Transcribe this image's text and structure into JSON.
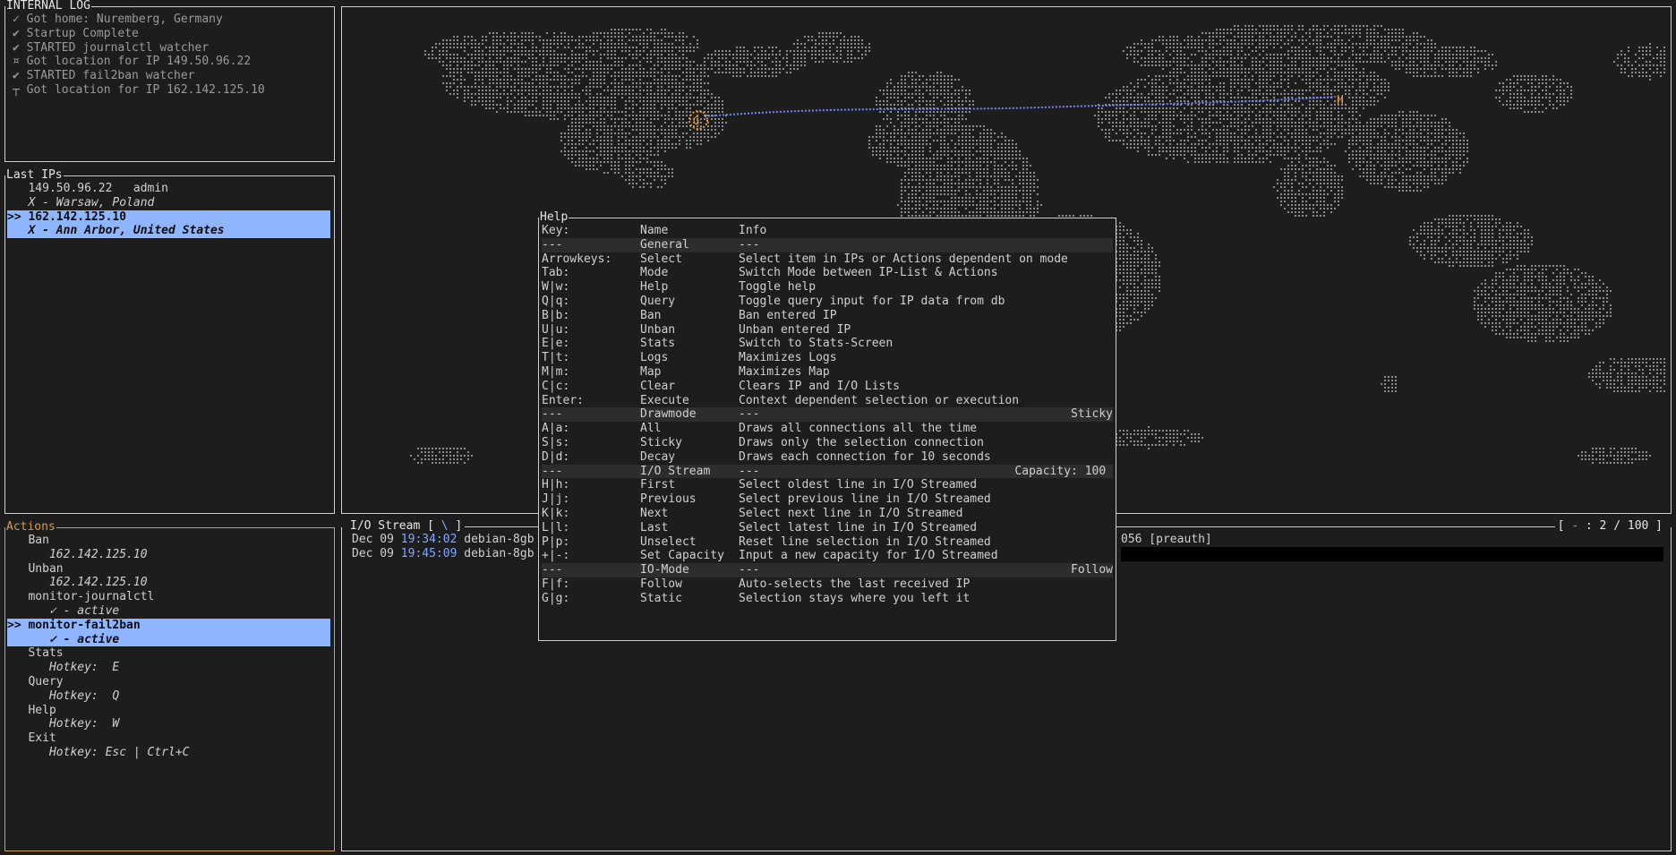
{
  "log_panel": {
    "title": "INTERNAL LOG",
    "lines": [
      "✓ Got home: Nuremberg, Germany",
      "✔ Startup Complete",
      "✔ STARTED journalctl watcher",
      "¤ Got location for IP 149.50.96.22",
      "✔ STARTED fail2ban watcher",
      "┬ Got location for IP 162.142.125.10"
    ]
  },
  "ips_panel": {
    "title": "Last IPs",
    "entries": [
      {
        "line1": "   149.50.96.22   admin",
        "line2": "   X - Warsaw, Poland",
        "selected": false
      },
      {
        "line1": ">> 162.142.125.10",
        "line2": "   X - Ann Arbor, United States",
        "selected": true
      }
    ]
  },
  "actions_panel": {
    "title": "Actions",
    "items": [
      {
        "name": "   Ban",
        "sub": "      162.142.125.10",
        "selected": false
      },
      {
        "name": "   Unban",
        "sub": "      162.142.125.10",
        "selected": false
      },
      {
        "name": "   monitor-journalctl",
        "sub": "      ✓ - active",
        "selected": false
      },
      {
        "name": ">> monitor-fail2ban",
        "sub": "      ✓ - active",
        "selected": true
      },
      {
        "name": "   Stats",
        "sub": "      Hotkey:  E",
        "selected": false
      },
      {
        "name": "   Query",
        "sub": "      Hotkey:  Q",
        "selected": false
      },
      {
        "name": "   Help",
        "sub": "      Hotkey:  W",
        "selected": false
      },
      {
        "name": "   Exit",
        "sub": "      Hotkey: Esc | Ctrl+C",
        "selected": false
      }
    ]
  },
  "map": {
    "home_marker": "H",
    "target_marker": "G",
    "land_color": "#8c8c8c",
    "connection_color": "#6f86ff",
    "marker_color": "#e39a3c"
  },
  "stream_panel": {
    "title_prefix": "I/O Stream [ ",
    "spinner": "\\",
    "title_suffix": " ]",
    "counter_prefix": "[ ",
    "counter_mode": "-",
    "counter_rest": " : 2 / 100 ]",
    "lines": [
      {
        "date": "Dec 09 ",
        "time": "19:34:02",
        "host": " debian-8gb",
        "tail": "056 [preauth]"
      },
      {
        "date": "Dec 09 ",
        "time": "19:45:09",
        "host": " debian-8gb",
        "tail": ""
      }
    ]
  },
  "help": {
    "title": "Help",
    "header": {
      "key": "Key:",
      "name": "Name",
      "info": "Info"
    },
    "rows": [
      {
        "key": "---",
        "name": "General",
        "info": "---",
        "extra": "",
        "section": true
      },
      {
        "key": "Arrowkeys:",
        "name": "Select",
        "info": "Select item in IPs or Actions dependent on mode",
        "extra": "",
        "section": false
      },
      {
        "key": "Tab:",
        "name": "Mode",
        "info": "Switch Mode between IP-List & Actions",
        "extra": "",
        "section": false
      },
      {
        "key": "W|w:",
        "name": "Help",
        "info": "Toggle help",
        "extra": "",
        "section": false
      },
      {
        "key": "Q|q:",
        "name": "Query",
        "info": "Toggle query input for IP data from db",
        "extra": "",
        "section": false
      },
      {
        "key": "B|b:",
        "name": "Ban",
        "info": "Ban entered IP",
        "extra": "",
        "section": false
      },
      {
        "key": "U|u:",
        "name": "Unban",
        "info": "Unban entered IP",
        "extra": "",
        "section": false
      },
      {
        "key": "E|e:",
        "name": "Stats",
        "info": "Switch to Stats-Screen",
        "extra": "",
        "section": false
      },
      {
        "key": "T|t:",
        "name": "Logs",
        "info": "Maximizes Logs",
        "extra": "",
        "section": false
      },
      {
        "key": "M|m:",
        "name": "Map",
        "info": "Maximizes Map",
        "extra": "",
        "section": false
      },
      {
        "key": "C|c:",
        "name": "Clear",
        "info": "Clears IP and I/O Lists",
        "extra": "",
        "section": false
      },
      {
        "key": "Enter:",
        "name": "Execute",
        "info": "Context dependent selection or execution",
        "extra": "",
        "section": false
      },
      {
        "key": "---",
        "name": "Drawmode",
        "info": "---",
        "extra": "Sticky",
        "section": true
      },
      {
        "key": "A|a:",
        "name": "All",
        "info": "Draws all connections all the time",
        "extra": "",
        "section": false
      },
      {
        "key": "S|s:",
        "name": "Sticky",
        "info": "Draws only the selection connection",
        "extra": "",
        "section": false
      },
      {
        "key": "D|d:",
        "name": "Decay",
        "info": "Draws each connection for 10 seconds",
        "extra": "",
        "section": false
      },
      {
        "key": "---",
        "name": "I/O Stream",
        "info": "---",
        "extra": "Capacity: 100 ",
        "section": true
      },
      {
        "key": "H|h:",
        "name": "First",
        "info": "Select oldest line in I/O Streamed",
        "extra": "",
        "section": false
      },
      {
        "key": "J|j:",
        "name": "Previous",
        "info": "Select previous line in I/O Streamed",
        "extra": "",
        "section": false
      },
      {
        "key": "K|k:",
        "name": "Next",
        "info": "Select next line in I/O Streamed",
        "extra": "",
        "section": false
      },
      {
        "key": "L|l:",
        "name": "Last",
        "info": "Select latest line in I/O Streamed",
        "extra": "",
        "section": false
      },
      {
        "key": "P|p:",
        "name": "Unselect",
        "info": "Reset line selection in I/O Streamed",
        "extra": "",
        "section": false
      },
      {
        "key": "+|-:",
        "name": "Set Capacity",
        "info": "Input a new capacity for I/O Streamed",
        "extra": "",
        "section": false
      },
      {
        "key": "---",
        "name": "IO-Mode",
        "info": "---",
        "extra": "Follow",
        "section": true
      },
      {
        "key": "F|f:",
        "name": "Follow",
        "info": "Auto-selects the last received IP",
        "extra": "",
        "section": false
      },
      {
        "key": "G|g:",
        "name": "Static",
        "info": "Selection stays where you left it",
        "extra": "",
        "section": false
      }
    ]
  }
}
